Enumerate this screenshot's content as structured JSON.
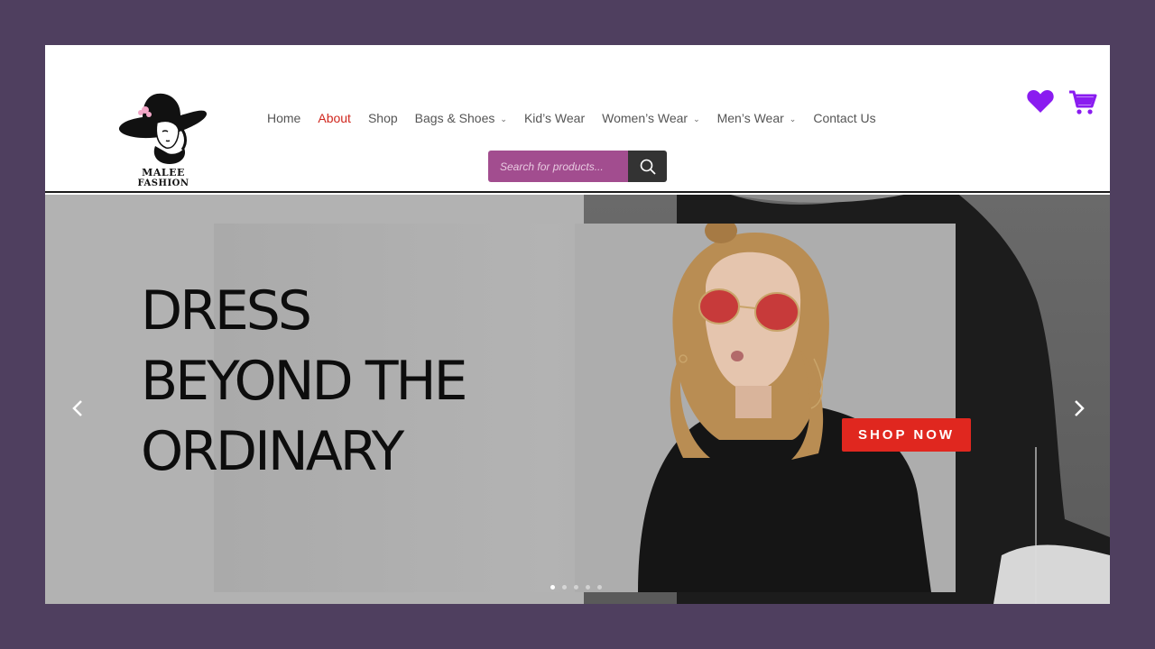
{
  "brand": {
    "line1": "MALEE",
    "line2": "FASHION"
  },
  "nav": {
    "items": [
      {
        "label": "Home",
        "active": false,
        "dropdown": false
      },
      {
        "label": "About",
        "active": true,
        "dropdown": false
      },
      {
        "label": "Shop",
        "active": false,
        "dropdown": false
      },
      {
        "label": "Bags & Shoes",
        "active": false,
        "dropdown": true
      },
      {
        "label": "Kid’s Wear",
        "active": false,
        "dropdown": false
      },
      {
        "label": "Women’s Wear",
        "active": false,
        "dropdown": true
      },
      {
        "label": "Men’s Wear",
        "active": false,
        "dropdown": true
      },
      {
        "label": "Contact Us",
        "active": false,
        "dropdown": false
      }
    ]
  },
  "search": {
    "placeholder": "Search for products..."
  },
  "icons": {
    "wishlist": "heart-icon",
    "cart": "cart-icon",
    "search": "search-icon"
  },
  "hero": {
    "headline": [
      "DRESS",
      "BEYOND THE",
      "ORDINARY"
    ],
    "cta": "SHOP NOW",
    "slides": 5,
    "active_slide": 0
  },
  "colors": {
    "accent_purple": "#8a1cf0",
    "nav_active": "#d0271e",
    "search_bg": "#a24d8f",
    "cta_bg": "#e0271f",
    "page_bg": "#4f3f5f"
  }
}
